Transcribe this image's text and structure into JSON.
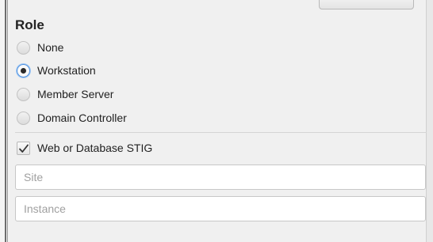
{
  "role": {
    "title": "Role",
    "options": [
      {
        "label": "None",
        "selected": false
      },
      {
        "label": "Workstation",
        "selected": true
      },
      {
        "label": "Member Server",
        "selected": false
      },
      {
        "label": "Domain Controller",
        "selected": false
      }
    ]
  },
  "stig": {
    "label": "Web or Database STIG",
    "checked": true
  },
  "fields": {
    "site": {
      "value": "",
      "placeholder": "Site"
    },
    "instance": {
      "value": "",
      "placeholder": "Instance"
    }
  },
  "colors": {
    "selected_radio_border": "#4a8fe0",
    "text": "#222222",
    "placeholder": "#a0a0a0"
  }
}
